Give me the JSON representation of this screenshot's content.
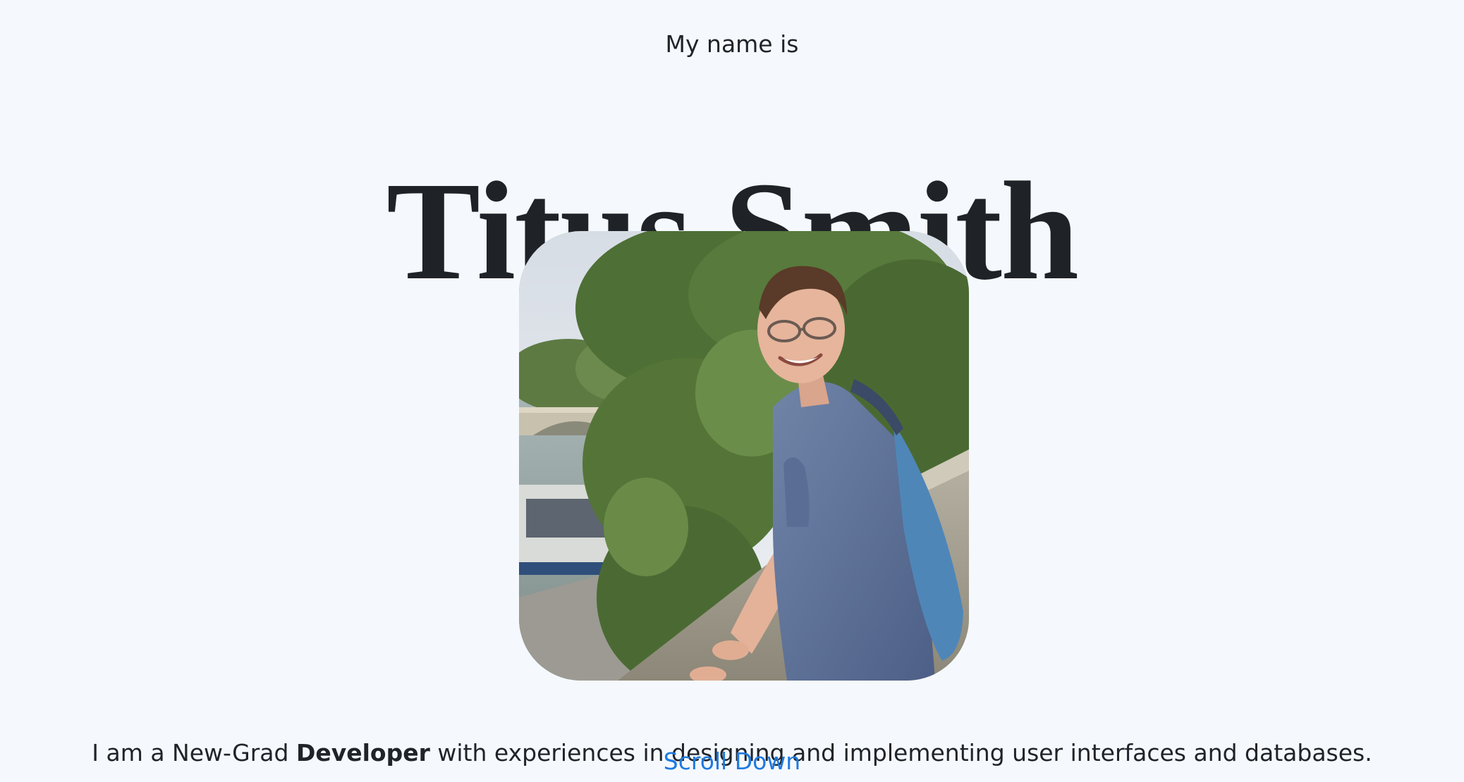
{
  "hero": {
    "intro": "My name is",
    "name": "Titus Smith",
    "photo_alt": "Portrait photo",
    "tagline": {
      "before": "I am a New-Grad ",
      "bold": "Developer",
      "after": " with experiences in designing and implementing user interfaces and databases."
    },
    "scroll_label": "Scroll Down"
  },
  "colors": {
    "background": "#f5f9fd",
    "text": "#202428",
    "link": "#1f7ae0"
  }
}
